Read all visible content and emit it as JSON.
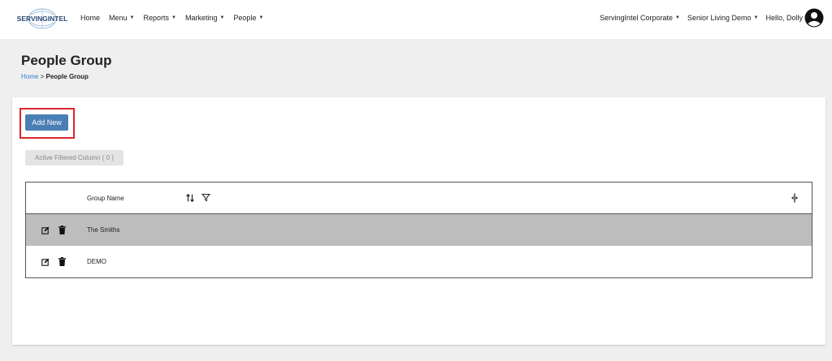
{
  "brand": {
    "logo_text": "SERVINGINTEL"
  },
  "nav": {
    "items": [
      {
        "label": "Home",
        "dropdown": false
      },
      {
        "label": "Menu",
        "dropdown": true
      },
      {
        "label": "Reports",
        "dropdown": true
      },
      {
        "label": "Marketing",
        "dropdown": true
      },
      {
        "label": "People",
        "dropdown": true
      }
    ],
    "org": "ServingIntel Corporate",
    "site": "Senior Living Demo",
    "greeting": "Hello, Dolly"
  },
  "page": {
    "title": "People Group",
    "breadcrumb": {
      "home": "Home",
      "separator": ">",
      "current": "People Group"
    }
  },
  "toolbar": {
    "add_label": "Add New",
    "filter_chip": "Active Filtered Column ( 0 )"
  },
  "grid": {
    "columns": [
      {
        "label": "Group Name"
      }
    ],
    "rows": [
      {
        "name": "The Smiths",
        "selected": true
      },
      {
        "name": "DEMO",
        "selected": false
      }
    ]
  },
  "colors": {
    "accent": "#4a7fb5",
    "highlight": "#d9262c",
    "selected_row": "#bdbdbd",
    "link": "#3a7bd5"
  },
  "icons": [
    "servingintel-logo",
    "chevron-down-icon",
    "user-avatar-icon",
    "sort-icon",
    "filter-icon",
    "column-resize-icon",
    "edit-icon",
    "trash-icon"
  ]
}
